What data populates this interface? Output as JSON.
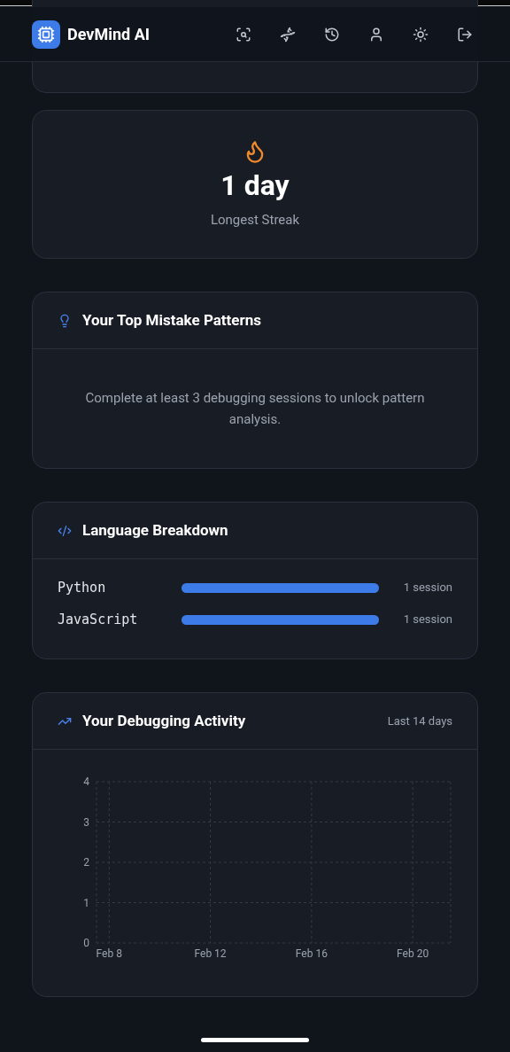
{
  "header": {
    "title": "DevMind AI",
    "nav": [
      {
        "kind": "scan"
      },
      {
        "kind": "dna"
      },
      {
        "kind": "history"
      },
      {
        "kind": "profile"
      },
      {
        "kind": "theme"
      },
      {
        "kind": "logout"
      }
    ]
  },
  "longest_streak": {
    "value": "1 day",
    "label": "Longest Streak"
  },
  "mistake_patterns": {
    "title": "Your Top Mistake Patterns",
    "message": "Complete at least 3 debugging sessions to unlock pattern analysis."
  },
  "language_breakdown": {
    "title": "Language Breakdown",
    "rows": [
      {
        "language": "Python",
        "level": 1,
        "count": "1 session"
      },
      {
        "language": "JavaScript",
        "level": 1,
        "count": "1 session"
      }
    ]
  },
  "activity": {
    "title": "Your Debugging Activity",
    "range": "Last 14 days",
    "chart_data": {
      "type": "area",
      "grid": true,
      "ylim": [
        0,
        4
      ],
      "yticks": [
        0,
        1,
        2,
        3,
        4
      ],
      "categories": [
        "Feb 8",
        null,
        null,
        null,
        "Feb 12",
        null,
        null,
        null,
        "Feb 16",
        null,
        null,
        null,
        "Feb 20",
        null
      ]
    }
  }
}
